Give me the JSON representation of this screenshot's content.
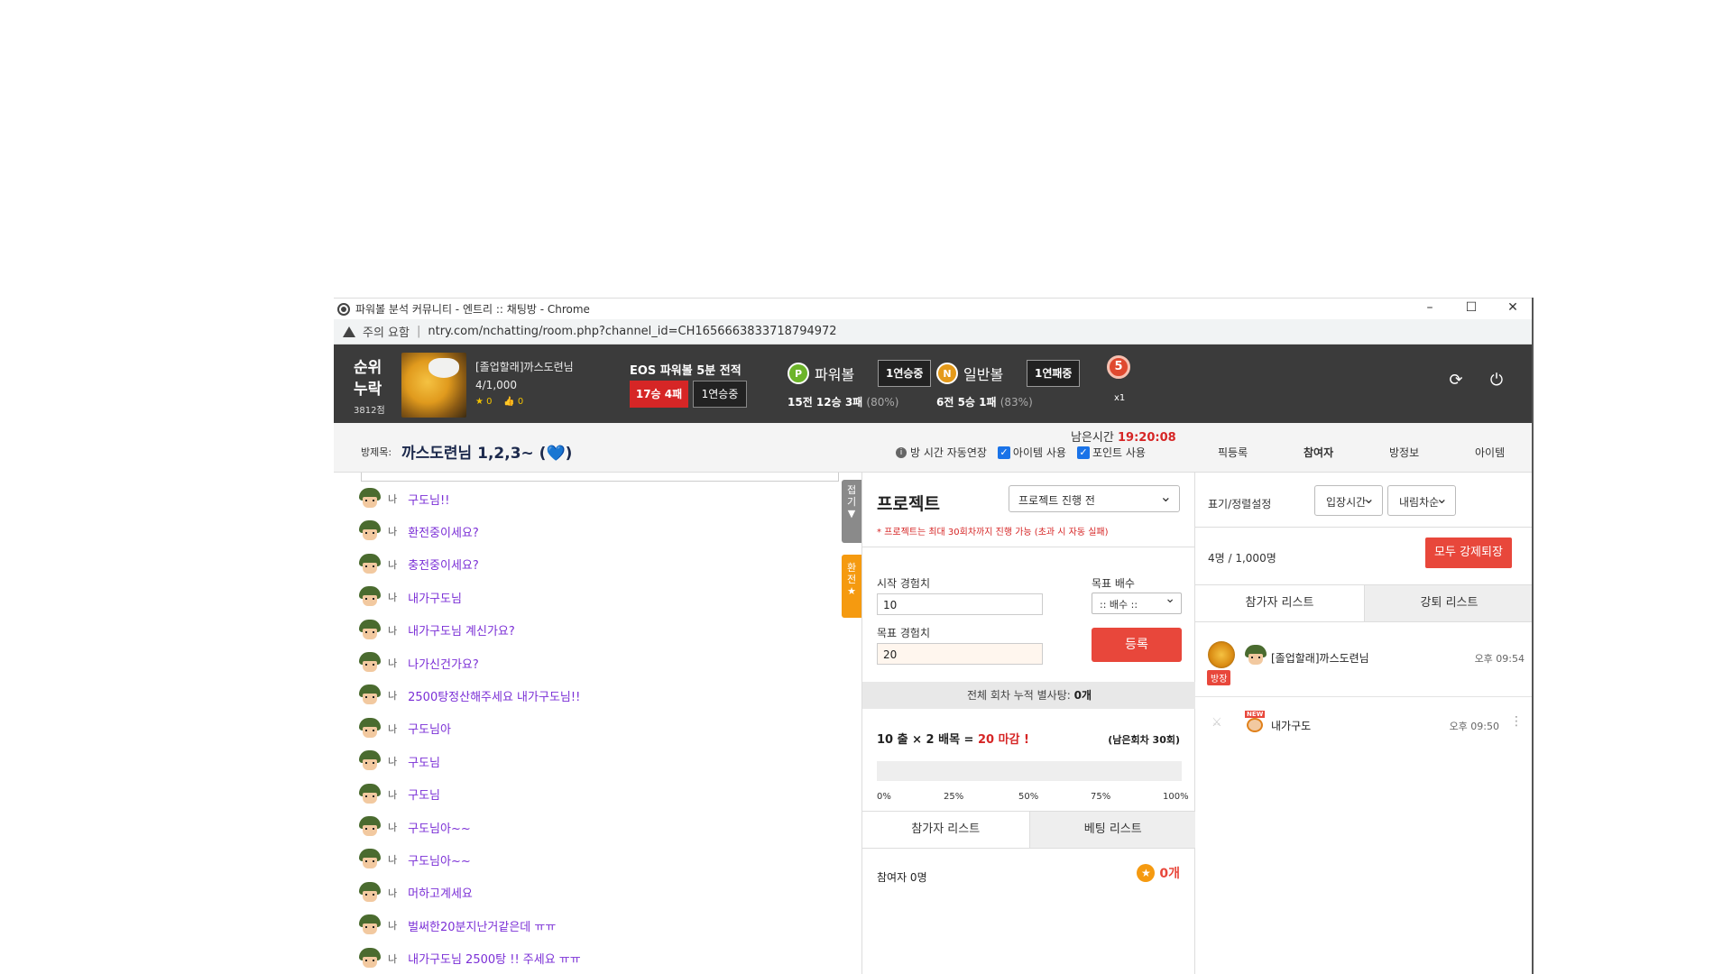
{
  "window": {
    "title": "파워볼 분석 커뮤니티 - 엔트리 :: 채팅방 - Chrome",
    "controls": [
      "–",
      "☐",
      "✕"
    ]
  },
  "address": {
    "warning": "주의 요함",
    "url": "ntry.com/nchatting/room.php?channel_id=CH1656663833718794972"
  },
  "header": {
    "rank_line1": "순위",
    "rank_line2": "누락",
    "points": "3812점",
    "username": "[졸업할래]까스도련님",
    "user_count": "4/1,000",
    "stars": "0",
    "likes": "0",
    "eos_title": "EOS 파워볼 5분 전적",
    "eos_record": "17승 4패",
    "eos_streak": "1연승중",
    "powerball_icon": "P",
    "powerball_label": "파워볼",
    "powerball_streak": "1연승중",
    "powerball_record": "15전 12승 3패",
    "powerball_pct": "(80%)",
    "normalball_icon": "N",
    "normalball_label": "일반볼",
    "normalball_streak": "1연패중",
    "normalball_record": "6전 5승 1패",
    "normalball_pct": "(83%)",
    "medal_number": "5",
    "medal_mult": "x1",
    "refresh_icon": "refresh-icon",
    "power_icon": "power-icon"
  },
  "roombar": {
    "room_label": "방제목:",
    "room_title": "까스도련님 1,2,3~ (💙)",
    "timer_label": "남은시간",
    "timer_value": "19:20:08",
    "auto_extend": "방 시간 자동연장",
    "item_use": "아이템 사용",
    "point_use": "포인트 사용",
    "tabs": [
      "픽등록",
      "참여자",
      "방정보",
      "아이템"
    ]
  },
  "chat": {
    "messages": [
      {
        "who": "나",
        "text": "구도님!!"
      },
      {
        "who": "나",
        "text": "환전중이세요?"
      },
      {
        "who": "나",
        "text": "충전중이세요?"
      },
      {
        "who": "나",
        "text": "내가구도님"
      },
      {
        "who": "나",
        "text": "내가구도님 계신가요?"
      },
      {
        "who": "나",
        "text": "나가신건가요?"
      },
      {
        "who": "나",
        "text": "2500탕정산해주세요 내가구도님!!"
      },
      {
        "who": "나",
        "text": "구도님아"
      },
      {
        "who": "나",
        "text": "구도님"
      },
      {
        "who": "나",
        "text": "구도님"
      },
      {
        "who": "나",
        "text": "구도님아~~"
      },
      {
        "who": "나",
        "text": "구도님아~~"
      },
      {
        "who": "나",
        "text": "머하고계세요"
      },
      {
        "who": "나",
        "text": "벌써한20분지난거같은데 ㅠㅠ"
      },
      {
        "who": "나",
        "text": "내가구도님 2500탕 !! 주세요 ㅠㅠ"
      }
    ],
    "fold_tab": "접기",
    "exchange_tab": "환전"
  },
  "project": {
    "title": "프로젝트",
    "status_select": "프로젝트 진행 전",
    "note": "* 프로젝트는 최대 30회차까지 진행 가능 (초과 시 자동 실패)",
    "start_label": "시작 경험치",
    "start_value": "10",
    "multiplier_label": "목표 배수",
    "multiplier_select": ":: 배수 ::",
    "target_label": "목표 경험치",
    "target_value": "20",
    "register_button": "등록",
    "accum_label": "전체 회차 누적 별사탕:",
    "accum_value": "0개",
    "formula_start": "10 출",
    "formula_mult": "2 배목",
    "formula_result": "20 마감 !",
    "remaining": "(남은회차 30회)",
    "progress": 0,
    "ticks": [
      "0%",
      "25%",
      "50%",
      "75%",
      "100%"
    ],
    "tabs": [
      "참가자 리스트",
      "베팅 리스트"
    ],
    "participants": "참여자 0명",
    "coins": "0개"
  },
  "right": {
    "sort_label": "표기/정렬설정",
    "sort_select_1": "입장시간",
    "sort_select_2": "내림차순",
    "member_count": "4명 / 1,000명",
    "kick_all_button": "모두 강제퇴장",
    "tabs": [
      "참가자 리스트",
      "강퇴 리스트"
    ],
    "members": [
      {
        "badge": "방장",
        "name": "[졸업할래]까스도련님",
        "time": "오후 09:54"
      },
      {
        "name": "내가구도",
        "time": "오후 09:50",
        "new_tag": "NEW"
      }
    ]
  }
}
